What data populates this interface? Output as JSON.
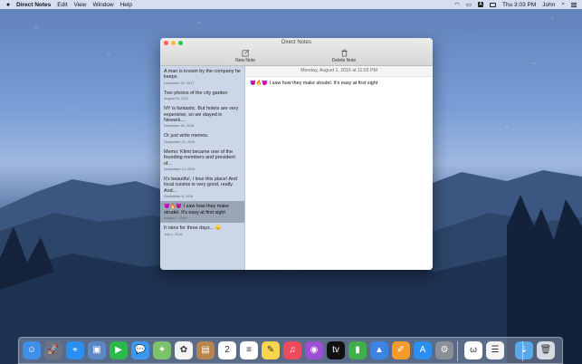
{
  "menubar": {
    "app_name": "Direct Notes",
    "menus": [
      "Edit",
      "View",
      "Window",
      "Help"
    ],
    "status": {
      "wifi_icon": "wifi-icon",
      "airplay_icon": "airplay-icon",
      "a_icon_label": "A",
      "battery_icon": "battery-icon",
      "time": "Thu 3:03 PM",
      "user": "John",
      "search_icon": "spotlight-icon",
      "list_icon": "notification-center-icon"
    }
  },
  "window": {
    "title": "Direct Notes",
    "toolbar": {
      "new_note_label": "New Note",
      "delete_note_label": "Delete Note"
    },
    "notes": [
      {
        "text": "A man is known by the company he keeps.",
        "date": "December 20, 2017"
      },
      {
        "text": "Two photos of the city garden",
        "date": "August 20, 2017"
      },
      {
        "text": "NY is fantastic. But hotels are very expensive, so we stayed in Newark....",
        "date": "November 20, 2016"
      },
      {
        "text": "Or just write memos.",
        "date": "September 22, 2016"
      },
      {
        "text": "Memo: Klimt became one of the founding members and president of...",
        "date": "September 13, 2016"
      },
      {
        "text": "It's beautiful, I love this place! And local cuisine is very good, really. And...",
        "date": "September 6, 2016"
      },
      {
        "text": "😈🔥😈 I saw how they make strudel. It's easy at first sight",
        "date": "August 1, 2016",
        "selected": true
      },
      {
        "text": "It rains for three days... 😞",
        "date": "July 1, 2016"
      }
    ],
    "detail": {
      "date": "Monday, August 1, 2016 at 11:02 PM",
      "body": "😈🔥😈 I saw how they make strudel. It's easy at first sight"
    }
  },
  "dock": {
    "items": [
      {
        "name": "finder-icon",
        "color": "#3f8fe8",
        "glyph": "☺"
      },
      {
        "name": "launchpad-icon",
        "color": "#6b7483",
        "glyph": "🚀"
      },
      {
        "name": "safari-icon",
        "color": "#2a8ff0",
        "glyph": "⌖"
      },
      {
        "name": "preview-icon",
        "color": "#5b87c4",
        "glyph": "▣"
      },
      {
        "name": "facetime-icon",
        "color": "#2db84c",
        "glyph": "▶"
      },
      {
        "name": "messages-icon",
        "color": "#3a9af2",
        "glyph": "💬"
      },
      {
        "name": "maps-icon",
        "color": "#7ac36a",
        "glyph": "✦"
      },
      {
        "name": "photos-icon",
        "color": "#f2f2f2",
        "glyph": "✿"
      },
      {
        "name": "contacts-icon",
        "color": "#b4854c",
        "glyph": "▤"
      },
      {
        "name": "calendar-icon",
        "color": "#ffffff",
        "glyph": "2"
      },
      {
        "name": "reminders-icon",
        "color": "#ffffff",
        "glyph": "≡"
      },
      {
        "name": "notes-icon",
        "color": "#f7d54c",
        "glyph": "✎"
      },
      {
        "name": "music-icon",
        "color": "#f04a5e",
        "glyph": "♫"
      },
      {
        "name": "podcasts-icon",
        "color": "#9b4fd1",
        "glyph": "◉"
      },
      {
        "name": "tv-icon",
        "color": "#111111",
        "glyph": "tv"
      },
      {
        "name": "numbers-icon",
        "color": "#3fae4b",
        "glyph": "▮"
      },
      {
        "name": "keynote-icon",
        "color": "#3c84e2",
        "glyph": "▲"
      },
      {
        "name": "pages-icon",
        "color": "#f39c2a",
        "glyph": "✐"
      },
      {
        "name": "app-store-icon",
        "color": "#2a8ff0",
        "glyph": "A"
      },
      {
        "name": "system-preferences-icon",
        "color": "#8a8f98",
        "glyph": "⚙"
      },
      {
        "name": "direct-notes-icon",
        "color": "#ffffff",
        "glyph": "ω"
      },
      {
        "name": "textedit-icon",
        "color": "#f4f4f4",
        "glyph": "☰"
      },
      {
        "name": "downloads-folder-icon",
        "color": "#5aa8e8",
        "glyph": "⇣"
      },
      {
        "name": "trash-icon",
        "color": "#d6dae2",
        "glyph": "🗑"
      }
    ]
  }
}
